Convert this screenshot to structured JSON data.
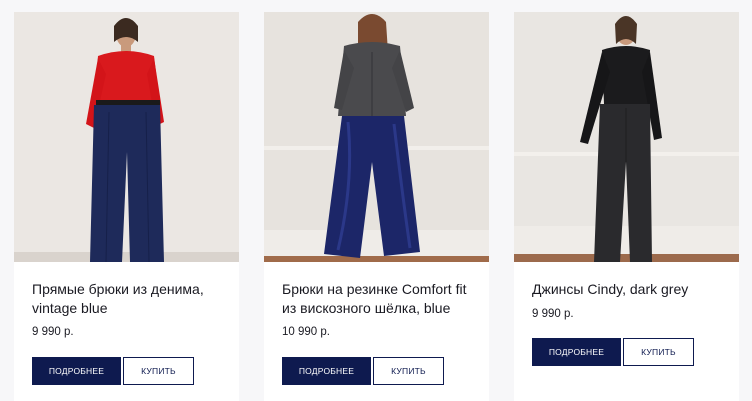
{
  "products": [
    {
      "title": "Прямые брюки из денима, vintage blue",
      "price": "9 990 р.",
      "details_label": "ПОДРОБНЕЕ",
      "buy_label": "КУПИТЬ"
    },
    {
      "title": "Брюки на резинке Comfort fit из вискозного шёлка, blue",
      "price": "10 990 р.",
      "details_label": "ПОДРОБНЕЕ",
      "buy_label": "КУПИТЬ"
    },
    {
      "title": "Джинсы Cindy, dark grey",
      "price": "9 990 р.",
      "details_label": "ПОДРОБНЕЕ",
      "buy_label": "КУПИТЬ"
    }
  ],
  "colors": {
    "accent_navy": "#0e1a4f",
    "page_bg": "#f7f7f9",
    "card_bg": "#ffffff"
  }
}
